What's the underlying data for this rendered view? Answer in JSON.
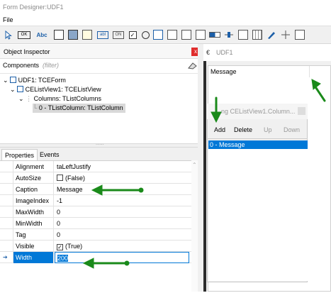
{
  "window": {
    "title": "Form Designer:UDF1"
  },
  "menu": {
    "file": "File"
  },
  "toolbar": {
    "abc_label": "Abc",
    "ok_label": "OK",
    "abl_label": "abl",
    "on_label": "ON"
  },
  "object_inspector": {
    "title": "Object Inspector",
    "close_label": "x",
    "components_label": "Components",
    "filter_placeholder": "(filter)",
    "tree": [
      {
        "label": "UDF1: TCEForm"
      },
      {
        "label": "CEListView1: TCEListView"
      },
      {
        "label": "Columns: TListColumns"
      },
      {
        "label": "0 - TListColumn: TListColumn"
      }
    ],
    "splitter_dots": "......",
    "tabs": [
      "Properties",
      "Events"
    ],
    "properties": [
      {
        "name": "Alignment",
        "value": "taLeftJustify"
      },
      {
        "name": "AutoSize",
        "value": "(False)",
        "checkbox": false
      },
      {
        "name": "Caption",
        "value": "Message"
      },
      {
        "name": "ImageIndex",
        "value": "-1"
      },
      {
        "name": "MaxWidth",
        "value": "0"
      },
      {
        "name": "MinWidth",
        "value": "0"
      },
      {
        "name": "Tag",
        "value": "0"
      },
      {
        "name": "Visible",
        "value": "(True)",
        "checkbox": true
      },
      {
        "name": "Width",
        "value": "200"
      }
    ]
  },
  "form": {
    "title": "UDF1",
    "listview_header": "Message",
    "dialog": {
      "title": "ng CEListView1.Column...",
      "add": "Add",
      "delete": "Delete",
      "up": "Up",
      "down": "Down",
      "items": [
        "0 - Message"
      ]
    }
  },
  "colors": {
    "selection": "#0078d7",
    "arrow": "#1a8a1a",
    "close": "#e02d2d"
  }
}
